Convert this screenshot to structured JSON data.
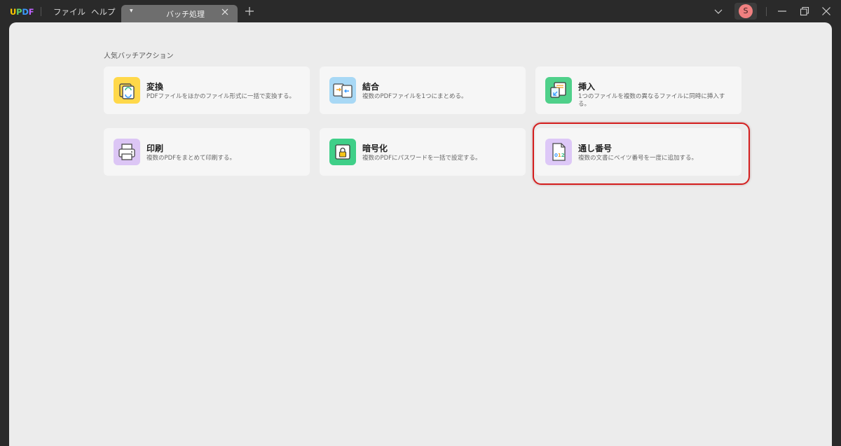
{
  "app": {
    "logo": "UPDF",
    "logo_colors": [
      "#ffcb00",
      "#5fd16b",
      "#3a9bff",
      "#c062ff"
    ]
  },
  "menu": {
    "file": "ファイル",
    "help": "ヘルプ"
  },
  "tab": {
    "title": "バッチ処理"
  },
  "user": {
    "avatar_initial": "S",
    "avatar_color": "#f08080"
  },
  "section": {
    "title": "人気バッチアクション"
  },
  "cards": [
    {
      "title": "変換",
      "desc": "PDFファイルをほかのファイル形式に一括で変換する。",
      "icon": "convert-icon",
      "color": "#ffd84a"
    },
    {
      "title": "結合",
      "desc": "複数のPDFファイルを1つにまとめる。",
      "icon": "combine-icon",
      "color": "#a8d8f5"
    },
    {
      "title": "挿入",
      "desc": "1つのファイルを複数の異なるファイルに同時に挿入する。",
      "icon": "insert-icon",
      "color": "#4fd08a"
    },
    {
      "title": "印刷",
      "desc": "複数のPDFをまとめて印刷する。",
      "icon": "print-icon",
      "color": "#dcc6f5"
    },
    {
      "title": "暗号化",
      "desc": "複数のPDFにパスワードを一括で設定する。",
      "icon": "lock-icon",
      "color": "#3fcf88"
    },
    {
      "title": "通し番号",
      "desc": "複数の文書にベイツ番号を一度に追加する。",
      "icon": "bates-number-icon",
      "color": "#ddc8f7"
    }
  ],
  "highlight_color": "#d41f1f"
}
